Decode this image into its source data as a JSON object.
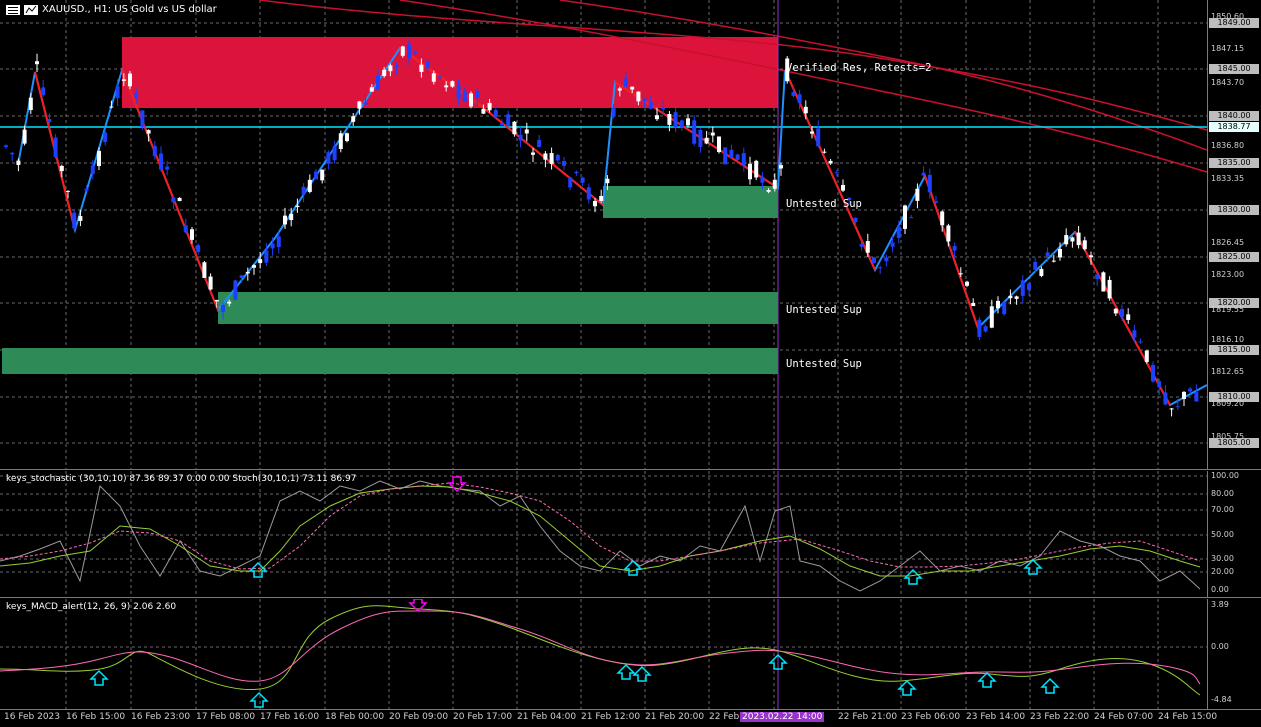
{
  "chart_header": {
    "symbol_title": "XAUUSD., H1:  US Gold vs US dollar"
  },
  "zones": {
    "resistance_label": "Verified Res, Retests=2",
    "support_labels": [
      "Untested Sup",
      "Untested Sup",
      "Untested Sup"
    ]
  },
  "price_axis": {
    "labels": [
      "1850.60",
      "1849.00",
      "1847.15",
      "1845.00",
      "1843.70",
      "1840.00",
      "1838.77",
      "1836.80",
      "1835.00",
      "1833.35",
      "1830.00",
      "1826.45",
      "1825.00",
      "1823.00",
      "1820.00",
      "1819.55",
      "1816.10",
      "1815.00",
      "1812.65",
      "1810.00",
      "1809.20",
      "1805.75",
      "1805.00"
    ],
    "current_price": "1838.77"
  },
  "stochastic": {
    "title": "keys_stochastic (30,10,10) 87.36 89.37 0.00 0.00 Stoch(30,10,1) 73.11 86.97",
    "axis_labels": [
      "100.00",
      "80.00",
      "70.00",
      "50.00",
      "30.00",
      "20.00",
      "0.00"
    ]
  },
  "macd": {
    "title": "keys_MACD_alert(12, 26, 9) 2.06 2.60",
    "axis_labels": [
      "3.89",
      "0.00",
      "-4.84"
    ]
  },
  "time_axis": {
    "labels": [
      "16 Feb 2023",
      "16 Feb 15:00",
      "16 Feb 23:00",
      "17 Feb 08:00",
      "17 Feb 16:00",
      "18 Feb 00:00",
      "20 Feb 09:00",
      "20 Feb 17:00",
      "21 Feb 04:00",
      "21 Feb 12:00",
      "21 Feb 20:00",
      "22 Feb",
      "2023.02.22 14:00",
      "22 Feb 21:00",
      "23 Feb 06:00",
      "23 Feb 14:00",
      "23 Feb 22:00",
      "24 Feb 07:00",
      "24 Feb 15:00"
    ],
    "highlighted": "2023.02.22 14:00"
  },
  "colors": {
    "resistance_zone": "#dc143c",
    "support_zone": "#2e8b57",
    "bull_candle": "#ffffff",
    "bear_candle": "#1e40ff",
    "zigzag_up": "#1e90ff",
    "zigzag_down": "#ff1a1a",
    "ma_lines": "#c8102e",
    "current_price_line": "#00e5ff",
    "cursor_line": "#9933cc",
    "stoch_main": "#9acd32",
    "macd_signal": "#ff69b4",
    "arrow_up": "#00e5ff",
    "arrow_down": "#ff00ff"
  }
}
